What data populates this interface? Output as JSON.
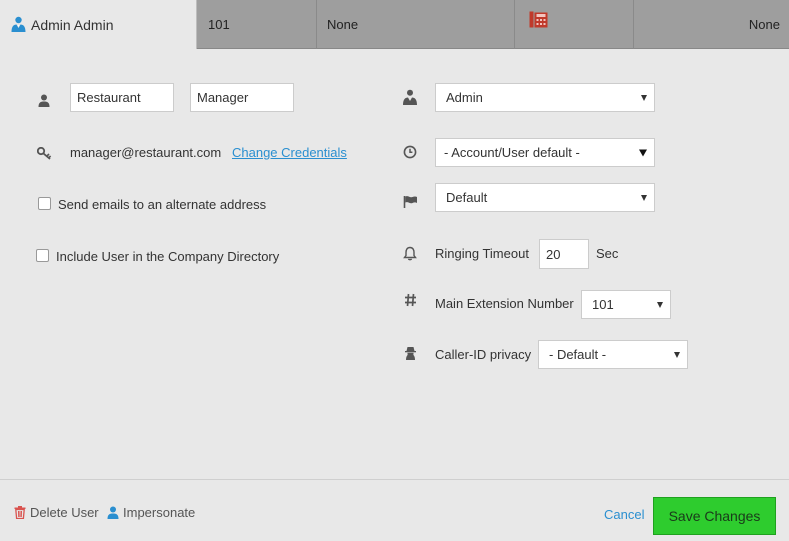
{
  "header": {
    "user_name": "Admin Admin",
    "extension": "101",
    "device_status": "None",
    "line_status": "None"
  },
  "profile": {
    "first_name": "Restaurant",
    "last_name": "Manager",
    "email": "manager@restaurant.com",
    "change_credentials_label": "Change Credentials",
    "send_alt_email_label": "Send emails to an alternate address",
    "send_alt_email_checked": false,
    "include_directory_label": "Include User in the Company Directory",
    "include_directory_checked": false
  },
  "settings": {
    "role_value": "Admin",
    "timezone_value": "- Account/User default -",
    "language_value": "Default",
    "ringing_timeout_label": "Ringing Timeout",
    "ringing_timeout_value": "20",
    "ringing_timeout_unit": "Sec",
    "main_extension_label": "Main Extension Number",
    "main_extension_value": "101",
    "caller_id_label": "Caller-ID privacy",
    "caller_id_value": "- Default -"
  },
  "footer": {
    "delete_label": "Delete User",
    "impersonate_label": "Impersonate",
    "cancel_label": "Cancel",
    "save_label": "Save Changes"
  },
  "colors": {
    "accent_link": "#2a8fd0",
    "save_button": "#2ecc2e",
    "phone_icon": "#c0392b",
    "delete_icon": "#d9534f"
  }
}
